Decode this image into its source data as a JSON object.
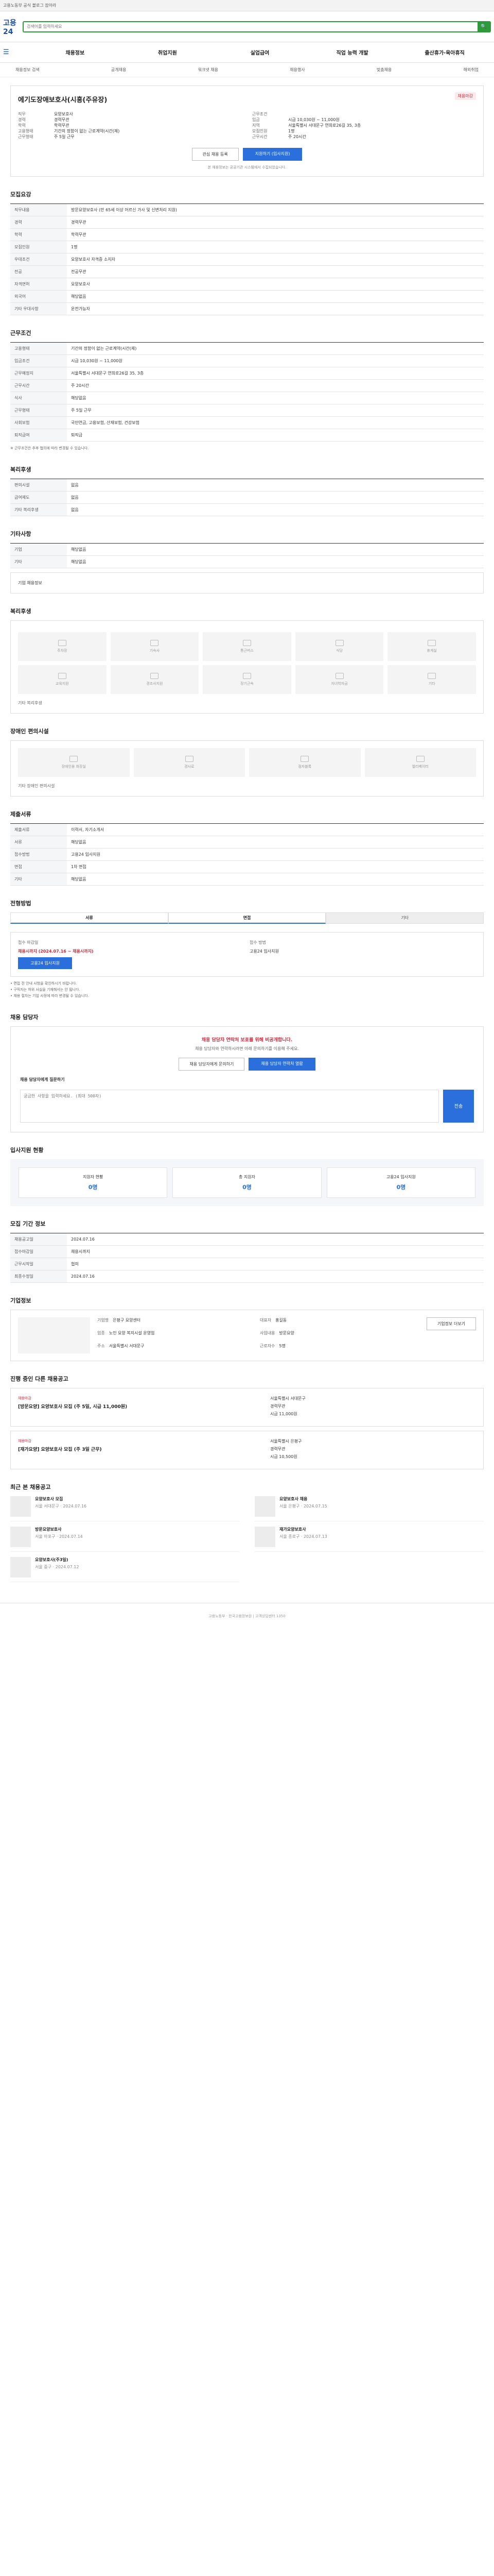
{
  "topbar": {
    "text": "고용노동부 공식 블로그 잡아라"
  },
  "header": {
    "logo": "고용24",
    "search_placeholder": "검색어를 입력하세요"
  },
  "gnb": {
    "items": [
      "채용정보",
      "취업지원",
      "실업급여",
      "직업 능력 개발",
      "출산휴가·육아휴직"
    ]
  },
  "subnav": [
    "채용정보 검색",
    "공개채용",
    "워크넷 채용",
    "채용행사",
    "맞춤채용",
    "해외취업"
  ],
  "job": {
    "title": "에기도장애보호사(시흥(주유장)",
    "badge": "채용마감",
    "left": [
      [
        "직무",
        "요양보호사"
      ],
      [
        "경력",
        "경력무관"
      ],
      [
        "학력",
        "학력무관"
      ],
      [
        "고용형태",
        "기간의 정함이 없는 근로계약(시간(제)"
      ],
      [
        "근무형태",
        "주 5일 근무"
      ]
    ],
    "right": [
      [
        "근무조건",
        ""
      ],
      [
        "임금",
        "시급 10,030원 ~ 11,000원"
      ],
      [
        "지역",
        "서울특별시 서대문구 연희로26길 35, 3층"
      ],
      [
        "모집인원",
        "1명"
      ],
      [
        "근무시간",
        "주 20시간"
      ]
    ],
    "btn_interest": "관심 채용 등록",
    "btn_apply": "지원하기 (입사지원)",
    "note": "본 채용정보는 공공기관 시스템에서 수집되었습니다."
  },
  "section_recruit": {
    "title": "모집요강",
    "rows": [
      [
        "직무내용",
        "방문요양보호사 (만 65세 이상 어르신 가사 및 신변처리 지원)"
      ],
      [
        "경력",
        "경력무관"
      ],
      [
        "학력",
        "학력무관"
      ],
      [
        "모집인원",
        "1명"
      ],
      [
        "우대조건",
        "요양보호사 자격증 소지자"
      ],
      [
        "전공",
        "전공무관"
      ],
      [
        "자격면허",
        "요양보호사"
      ],
      [
        "외국어",
        "해당없음"
      ],
      [
        "기타 우대사항",
        "운전가능자"
      ]
    ]
  },
  "section_conditions": {
    "title": "근무조건",
    "rows": [
      [
        "고용형태",
        "기간의 정함이 없는 근로계약(시간(제)"
      ],
      [
        "임금조건",
        "시급 10,030원 ~ 11,000원"
      ],
      [
        "근무예정지",
        "서울특별시 서대문구 연희로26길 35, 3층"
      ],
      [
        "근무시간",
        "주 20시간"
      ],
      [
        "식사",
        "해당없음"
      ],
      [
        "근무형태",
        "주 5일 근무"
      ],
      [
        "사회보험",
        "국민연금, 고용보험, 산재보험, 건강보험"
      ],
      [
        "퇴직급여",
        "퇴직금"
      ]
    ],
    "note": "※ 근무조건은 추후 협의에 따라 변경될 수 있습니다."
  },
  "section_welfare": {
    "title": "복리후생",
    "rows": [
      [
        "편의시설",
        "없음"
      ],
      [
        "급여제도",
        "없음"
      ],
      [
        "기타 복리후생",
        "없음"
      ]
    ]
  },
  "section_other": {
    "title": "기타사항",
    "rows": [
      [
        "기업",
        "해당없음"
      ],
      [
        "기타",
        "해당없음"
      ]
    ],
    "more": "기업 채용정보"
  },
  "section_benefit": {
    "title": "복리후생",
    "items": [
      "주차장",
      "기숙사",
      "통근버스",
      "식당",
      "휴게실",
      "교육지원",
      "경조사지원",
      "장기근속",
      "자녀학자금",
      "기타"
    ],
    "note": "기타 복리후생"
  },
  "section_disabled": {
    "title": "장애인 편의시설",
    "items": [
      "장애인용 화장실",
      "경사로",
      "점자블록",
      "엘리베이터"
    ],
    "note": "기타 장애인 편의시설"
  },
  "section_submit": {
    "title": "제출서류",
    "rows": [
      [
        "제출서류",
        "이력서, 자기소개서"
      ],
      [
        "서류",
        "해당없음"
      ],
      [
        "접수방법",
        "고용24 입사지원"
      ],
      [
        "면접",
        "1차 면접"
      ],
      [
        "기타",
        "해당없음"
      ]
    ]
  },
  "section_process": {
    "title": "전형방법",
    "tabs": [
      "서류",
      "면접",
      "기타"
    ],
    "left_label": "접수 마감일",
    "left_value": "채용시까지 (2024.07.16 ~ 채용시까지)",
    "left_btn": "고용24 입사지원",
    "right_label": "접수 방법",
    "right_value": "고용24 입사지원",
    "bullets": [
      "• 면접 전 안내 사항을 확인하시기 바랍니다.",
      "• 구직자는 허위 사실을 기재해서는 안 됩니다.",
      "• 채용 절차는 기업 사정에 따라 변경될 수 있습니다."
    ]
  },
  "section_contact": {
    "title": "채용 담당자",
    "warn": "채용 담당자 연락처 보호를 위해 비공개합니다.",
    "desc": "채용 담당자와 연락하시려면 아래 문의하기를 이용해 주세요.",
    "btn1": "채용 담당자에게 문의하기",
    "btn2": "채용 담당자 연락처 열람",
    "qa_label": "채용 담당자에게 질문하기",
    "qa_placeholder": "궁금한 사항을 입력하세요. (최대 500자)",
    "send": "전송"
  },
  "section_status": {
    "title": "입사지원 현황",
    "items": [
      [
        "지원자 현황",
        "0명"
      ],
      [
        "총 지원자",
        "0명"
      ],
      [
        "고용24 입사지원",
        "0명"
      ]
    ]
  },
  "section_info": {
    "title": "모집 기간 정보",
    "rows": [
      [
        "채용공고일",
        "2024.07.16"
      ],
      [
        "접수마감일",
        "채용시까지"
      ],
      [
        "근무시작일",
        "협의"
      ],
      [
        "최종수정일",
        "2024.07.16"
      ]
    ]
  },
  "section_company": {
    "title": "기업정보",
    "rows": [
      [
        "기업명",
        "은평구 요양센터"
      ],
      [
        "대표자",
        "홍길동"
      ],
      [
        "업종",
        "노인 요양 복지시설 운영업"
      ],
      [
        "사업내용",
        "방문요양"
      ],
      [
        "주소",
        "서울특별시 서대문구"
      ],
      [
        "근로자수",
        "5명"
      ]
    ],
    "btn": "기업정보 더보기"
  },
  "section_other_jobs": {
    "title": "진행 중인 다른 채용공고",
    "jobs": [
      {
        "tag": "채용마감",
        "title": "[방문요양] 요양보호사 모집 (주 5일, 시급 11,000원)",
        "a": "서울특별시 서대문구",
        "b": "경력무관",
        "c": "시급 11,000원"
      },
      {
        "tag": "채용마감",
        "title": "[재가요양] 요양보호사 모집 (주 3일 근무)",
        "a": "서울특별시 은평구",
        "b": "경력무관",
        "c": "시급 10,500원"
      }
    ]
  },
  "section_recent": {
    "title": "최근 본 채용공고",
    "items": [
      [
        "요양보호사 모집",
        "서울 서대문구 · 2024.07.16"
      ],
      [
        "요양보호사 채용",
        "서울 은평구 · 2024.07.15"
      ],
      [
        "방문요양보호사",
        "서울 마포구 · 2024.07.14"
      ],
      [
        "재가요양보호사",
        "서울 종로구 · 2024.07.13"
      ],
      [
        "요양보호사(주3일)",
        "서울 중구 · 2024.07.12"
      ]
    ]
  },
  "footer": "고용노동부 · 한국고용정보원 | 고객상담센터 1350"
}
